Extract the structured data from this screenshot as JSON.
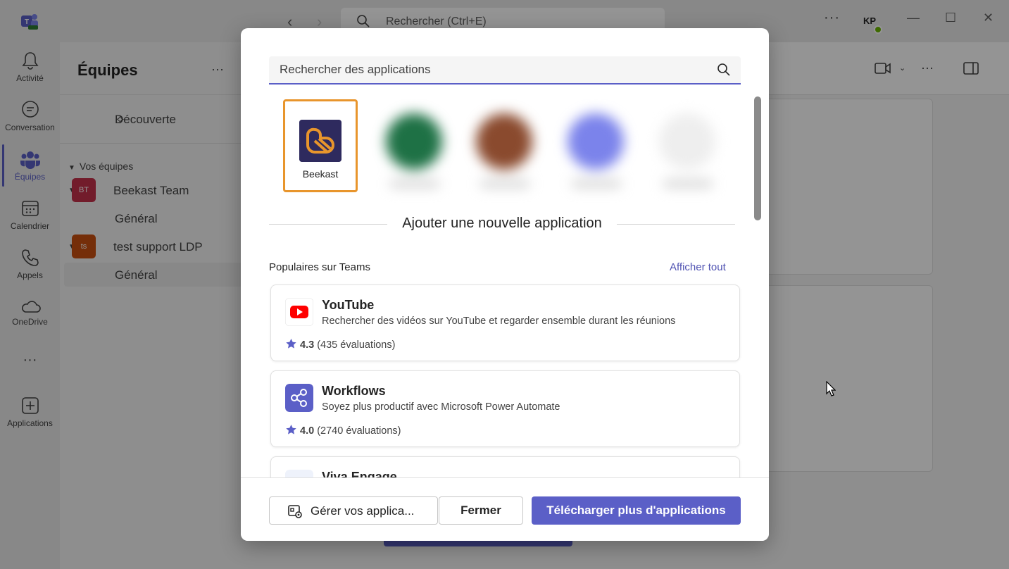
{
  "titlebar": {
    "search_placeholder": "Rechercher (Ctrl+E)",
    "more": "···",
    "user_initials": "KP"
  },
  "rail": [
    {
      "label": "Activité"
    },
    {
      "label": "Conversation"
    },
    {
      "label": "Équipes"
    },
    {
      "label": "Calendrier"
    },
    {
      "label": "Appels"
    },
    {
      "label": "OneDrive"
    },
    {
      "label": "···"
    },
    {
      "label": "Applications"
    }
  ],
  "teams_panel": {
    "title": "Équipes",
    "more": "···",
    "discover": "Découverte",
    "section_label": "Vos équipes",
    "teams": [
      {
        "badge": "BT",
        "name": "Beekast Team",
        "channel": "Général",
        "color": "#c4314b"
      },
      {
        "badge": "ts",
        "name": "test support LDP",
        "channel": "Général",
        "color": "#ca5010"
      }
    ]
  },
  "dialog": {
    "search_placeholder": "Rechercher des applications",
    "recent_app": {
      "name": "Beekast"
    },
    "add_title": "Ajouter une nouvelle application",
    "popular_title": "Populaires sur Teams",
    "see_all": "Afficher tout",
    "apps": [
      {
        "name": "YouTube",
        "description": "Rechercher des vidéos sur YouTube et regarder ensemble durant les réunions",
        "rating": "4.3",
        "reviews": "(435 évaluations)",
        "icon": "youtube-icon"
      },
      {
        "name": "Workflows",
        "description": "Soyez plus productif avec Microsoft Power Automate",
        "rating": "4.0",
        "reviews": "(2740 évaluations)",
        "icon": "workflows-icon"
      },
      {
        "name": "Viva Engage",
        "icon": "viva-engage-icon"
      }
    ],
    "buttons": {
      "manage": "Gérer vos applica...",
      "close": "Fermer",
      "get_more": "Télécharger plus d'applications"
    }
  },
  "colors": {
    "accent": "#5b5fc7",
    "highlight": "#e8952c",
    "youtube_red": "#ff0000"
  }
}
